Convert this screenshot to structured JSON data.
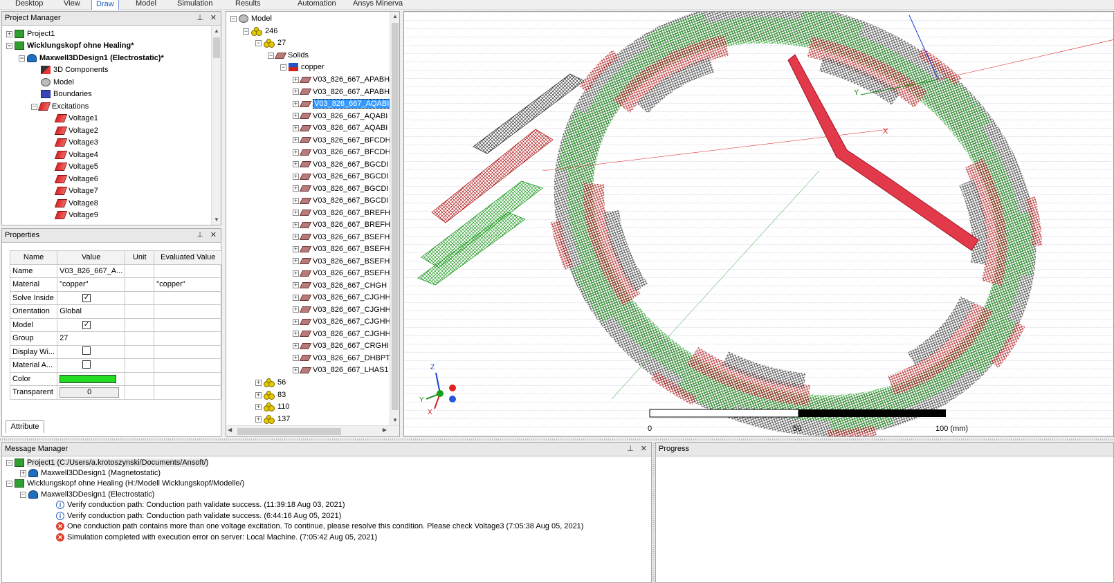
{
  "ribbon": {
    "tabs": [
      "Desktop",
      "View",
      "Draw",
      "Model",
      "Simulation",
      "Results",
      "Automation",
      "Ansys Minerva"
    ],
    "active_tab": "Draw"
  },
  "project_manager": {
    "title": "Project Manager",
    "items": [
      {
        "label": "Project1",
        "bold": false
      },
      {
        "label": "Wicklungskopf ohne Healing*",
        "bold": true
      },
      {
        "label": "Maxwell3DDesign1 (Electrostatic)*",
        "bold": true
      },
      {
        "label": "3D Components"
      },
      {
        "label": "Model"
      },
      {
        "label": "Boundaries"
      },
      {
        "label": "Excitations"
      },
      {
        "label": "Voltage1"
      },
      {
        "label": "Voltage2"
      },
      {
        "label": "Voltage3"
      },
      {
        "label": "Voltage4"
      },
      {
        "label": "Voltage5"
      },
      {
        "label": "Voltage6"
      },
      {
        "label": "Voltage7"
      },
      {
        "label": "Voltage8"
      },
      {
        "label": "Voltage9"
      }
    ]
  },
  "properties": {
    "title": "Properties",
    "headers": [
      "Name",
      "Value",
      "Unit",
      "Evaluated Value"
    ],
    "rows": [
      {
        "name": "Name",
        "value": "V03_826_667_A...",
        "unit": "",
        "evaluated": ""
      },
      {
        "name": "Material",
        "value": "\"copper\"",
        "unit": "",
        "evaluated": "\"copper\""
      },
      {
        "name": "Solve Inside",
        "value": "",
        "unit": "",
        "evaluated": ""
      },
      {
        "name": "Orientation",
        "value": "Global",
        "unit": "",
        "evaluated": ""
      },
      {
        "name": "Model",
        "value": "",
        "unit": "",
        "evaluated": ""
      },
      {
        "name": "Group",
        "value": "27",
        "unit": "",
        "evaluated": ""
      },
      {
        "name": "Display Wi...",
        "value": "",
        "unit": "",
        "evaluated": ""
      },
      {
        "name": "Material A...",
        "value": "",
        "unit": "",
        "evaluated": ""
      },
      {
        "name": "Color",
        "value": "",
        "unit": "",
        "evaluated": ""
      },
      {
        "name": "Transparent",
        "value": "0",
        "unit": "",
        "evaluated": ""
      }
    ],
    "checked": {
      "solve_inside": true,
      "model": true,
      "display_wireframe": false,
      "material_appearance": false
    },
    "color_hex": "#22dd22",
    "tab": "Attribute"
  },
  "model_tree": {
    "root": "Model",
    "group_246": "246",
    "group_27": "27",
    "solids": "Solids",
    "material": "copper",
    "solids_list": [
      "V03_826_667_APABH",
      "V03_826_667_APABH",
      "V03_826_667_AQABI",
      "V03_826_667_AQABI",
      "V03_826_667_AQABI",
      "V03_826_667_BFCDH",
      "V03_826_667_BFCDH",
      "V03_826_667_BGCDI",
      "V03_826_667_BGCDI",
      "V03_826_667_BGCDI",
      "V03_826_667_BGCDI",
      "V03_826_667_BREFH",
      "V03_826_667_BREFH",
      "V03_826_667_BSEFH",
      "V03_826_667_BSEFH",
      "V03_826_667_BSEFH",
      "V03_826_667_BSEFH",
      "V03_826_667_CHGH",
      "V03_826_667_CJGHH",
      "V03_826_667_CJGHH",
      "V03_826_667_CJGHH",
      "V03_826_667_CJGHH",
      "V03_826_667_CRGHI",
      "V03_826_667_DHBPT",
      "V03_826_667_LHAS1"
    ],
    "selected_index": 2,
    "other_groups": [
      "56",
      "83",
      "110",
      "137"
    ]
  },
  "viewport": {
    "scale_labels": [
      "0",
      "50",
      "100 (mm)"
    ],
    "axis_labels": {
      "z": "Z",
      "y": "Y",
      "x": "X"
    }
  },
  "message_manager": {
    "title": "Message Manager",
    "rows": [
      {
        "indent": 0,
        "icon": "project",
        "text": "Project1 (C:/Users/a.krotoszynski/Documents/Ansoft/)"
      },
      {
        "indent": 1,
        "icon": "design",
        "text": "Maxwell3DDesign1 (Magnetostatic)"
      },
      {
        "indent": 0,
        "icon": "project",
        "text": "Wicklungskopf ohne Healing (H:/Modell Wicklungskopf/Modelle/)"
      },
      {
        "indent": 1,
        "icon": "design",
        "text": "Maxwell3DDesign1 (Electrostatic)"
      },
      {
        "indent": 2,
        "icon": "info",
        "text": "Verify conduction path: Conduction path validate success. (11:39:18  Aug 03, 2021)"
      },
      {
        "indent": 2,
        "icon": "info",
        "text": "Verify conduction path: Conduction path validate success. (6:44:16  Aug 05, 2021)"
      },
      {
        "indent": 2,
        "icon": "error",
        "text": "One conduction path contains more than one voltage excitation. To continue, please resolve this condition. Please check Voltage3 (7:05:38  Aug 05, 2021)"
      },
      {
        "indent": 2,
        "icon": "error",
        "text": "Simulation completed with execution error on server: Local Machine. (7:05:42  Aug 05, 2021)"
      }
    ]
  },
  "progress": {
    "title": "Progress"
  }
}
